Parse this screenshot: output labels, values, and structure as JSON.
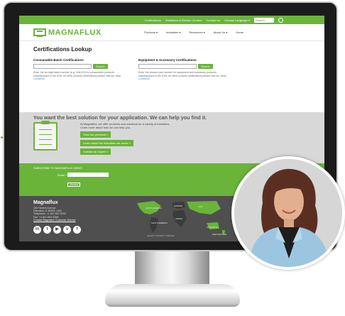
{
  "top_nav": {
    "links": [
      "Certifications",
      "Distributor & Service Centers",
      "Contact Us",
      "Choose Language ▾"
    ],
    "search_placeholder": "Search"
  },
  "brand": {
    "name": "MAGNAFLUX"
  },
  "main_nav": [
    "Products ▾",
    "Industries ▾",
    "Resources ▾",
    "About Us ▾",
    "Home"
  ],
  "lookup": {
    "title": "Certifications Lookup",
    "consumable": {
      "heading": "Consumable Batch Certifications",
      "button": "Search",
      "help": "Enter the six-digit batch number (e.g. 15A123) for consumable products manufactured in the USA, for other product certifications please visit our other",
      "link": "Locations."
    },
    "equipment": {
      "heading": "Equipment & Accessory Certifications",
      "button": "Search",
      "help": "Enter the product part number for equipment and accessory products manufactured in the USA, for other product certifications please visit our other",
      "link": "Locations."
    }
  },
  "promo": {
    "heading": "You want the best solution for your application. We can help you find it.",
    "line1": "At Magnaflux, we offer products and solutions for a variety of industries.",
    "line2": "Learn more about how we can help you.",
    "buttons": [
      "View our products »",
      "Learn about the industries we serve »",
      "Contact an expert »"
    ]
  },
  "subscribe": {
    "title": "SUBSCRIBE TO MAGNAFLUX NEWS",
    "email_label": "Email *",
    "submit": "Submit"
  },
  "footer": {
    "company": "Magnaflux",
    "address": [
      "155 Harlem Avenue",
      "Glenview, IL 60025, USA",
      "Telephone: +1 847-657-5300",
      "Fax: +1 847-657-5388"
    ],
    "contact_link": "Contact Magnaflux Customer Service",
    "social_icons": [
      "linkedin-icon",
      "twitter-icon",
      "youtube-icon",
      "vimeo-icon",
      "facebook-icon"
    ],
    "social_glyphs": [
      "in",
      "t",
      "▶",
      "v",
      "f"
    ],
    "map_regions": [
      "NORTH AMERICA",
      "EUROPE",
      "ASIA",
      "SOUTH AMERICA",
      "AFRICA",
      "AUSTRALIA",
      "NEW ZEALAND"
    ],
    "map_note": "SELECT COUNTRY / REGION"
  },
  "colors": {
    "brand_green": "#6ab43a",
    "footer_gray": "#4f4f4f",
    "promo_gray": "#d8d8d8"
  }
}
